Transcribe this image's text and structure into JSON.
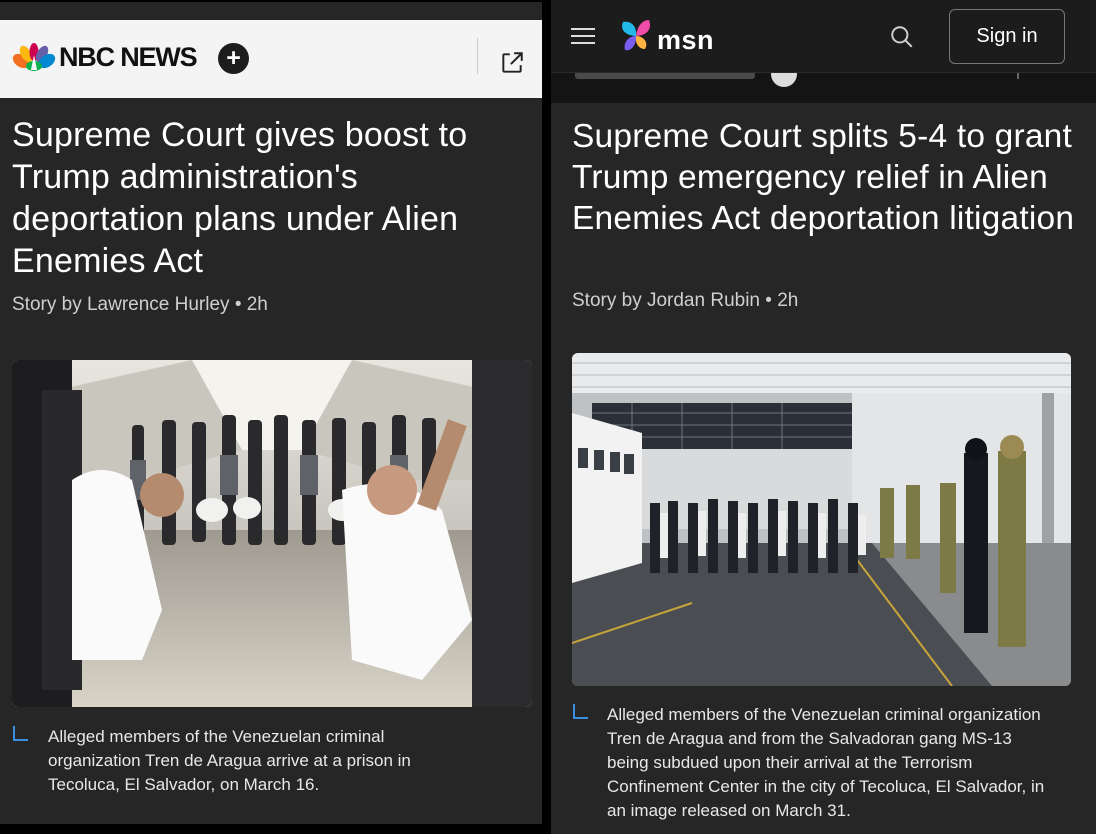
{
  "nbc": {
    "brand": "NBC NEWS",
    "plus_symbol": "+",
    "headline": "Supreme Court gives boost to Trump administration's deportation plans under Alien Enemies Act",
    "byline": "Story by Lawrence Hurley • 2h",
    "caption": "Alleged members of the Venezuelan criminal organization Tren de Aragua arrive at a prison in Tecoluca, El Salvador, on March 16.",
    "icons": [
      "peacock-logo",
      "plus-icon",
      "share-icon"
    ]
  },
  "msn": {
    "brand": "msn",
    "sign_in": "Sign in",
    "headline": "Supreme Court splits 5-4 to grant Trump emergency relief in Alien Enemies Act deportation litigation",
    "byline": "Story by Jordan Rubin • 2h",
    "caption": "Alleged members of the Venezuelan criminal organization Tren de Aragua and from the Salvadoran gang MS-13 being subdued upon their arrival at the Terrorism Confinement Center in the city of Tecoluca, El Salvador, in an image released on March 31.",
    "icons": [
      "hamburger-menu-icon",
      "msn-butterfly-logo",
      "search-icon"
    ]
  },
  "colors": {
    "panel_bg": "#262626",
    "nbc_header_bg": "#f4f4f4",
    "msn_header_bg": "#1c1c1c",
    "caption_accent": "#3b8fe0"
  }
}
